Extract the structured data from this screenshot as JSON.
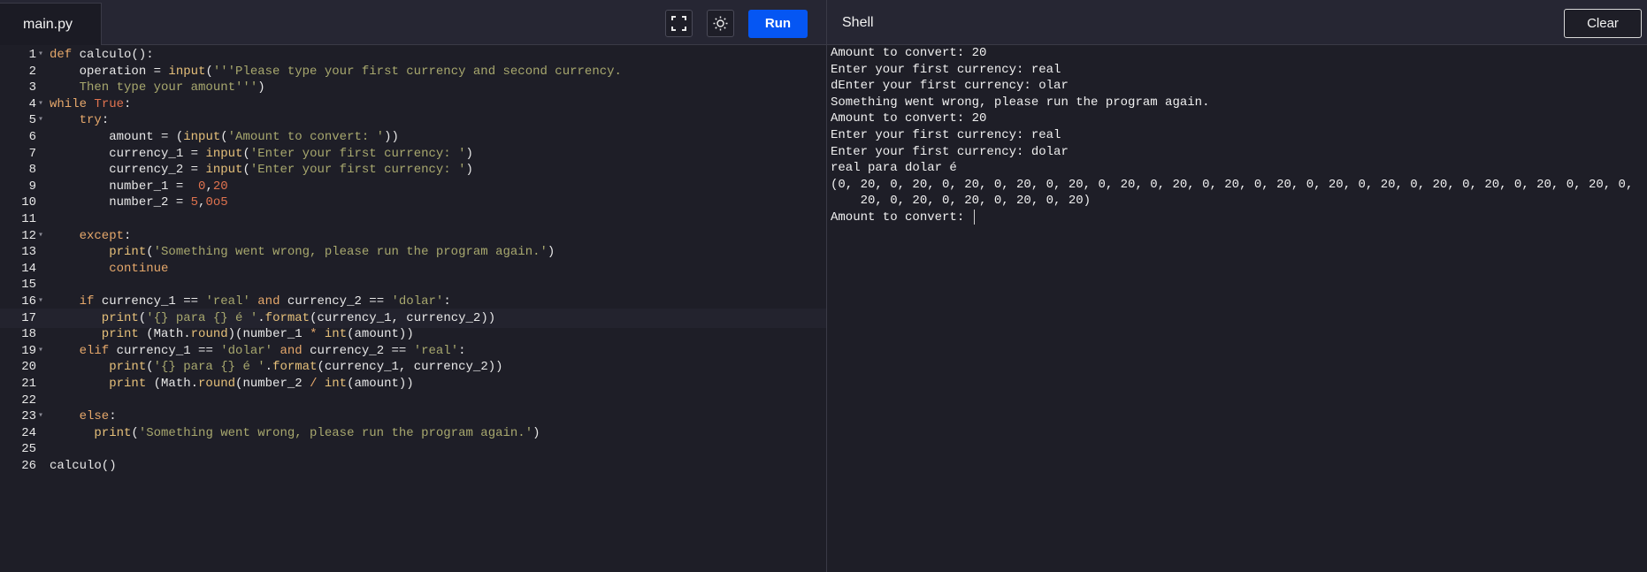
{
  "editor": {
    "tab_label": "main.py",
    "run_label": "Run",
    "lines": [
      {
        "num": "1",
        "fold": true,
        "tokens": [
          [
            "k",
            "def "
          ],
          [
            "t",
            "calculo():"
          ]
        ]
      },
      {
        "num": "2",
        "fold": false,
        "tokens": [
          [
            "t",
            "    operation = "
          ],
          [
            "f",
            "input"
          ],
          [
            "t",
            "("
          ],
          [
            "s",
            "'''Please type your first currency and second currency."
          ]
        ]
      },
      {
        "num": "3",
        "fold": false,
        "tokens": [
          [
            "s",
            "    Then type your amount'''"
          ],
          [
            "t",
            ")"
          ]
        ]
      },
      {
        "num": "4",
        "fold": true,
        "tokens": [
          [
            "k",
            "while "
          ],
          [
            "n",
            "True"
          ],
          [
            "t",
            ":"
          ]
        ]
      },
      {
        "num": "5",
        "fold": true,
        "tokens": [
          [
            "k",
            "    try"
          ],
          [
            "t",
            ":"
          ]
        ]
      },
      {
        "num": "6",
        "fold": false,
        "tokens": [
          [
            "t",
            "        amount = ("
          ],
          [
            "f",
            "input"
          ],
          [
            "t",
            "("
          ],
          [
            "s",
            "'Amount to convert: '"
          ],
          [
            "t",
            "))"
          ]
        ]
      },
      {
        "num": "7",
        "fold": false,
        "tokens": [
          [
            "t",
            "        currency_1 = "
          ],
          [
            "f",
            "input"
          ],
          [
            "t",
            "("
          ],
          [
            "s",
            "'Enter your first currency: '"
          ],
          [
            "t",
            ")"
          ]
        ]
      },
      {
        "num": "8",
        "fold": false,
        "tokens": [
          [
            "t",
            "        currency_2 = "
          ],
          [
            "f",
            "input"
          ],
          [
            "t",
            "("
          ],
          [
            "s",
            "'Enter your first currency: '"
          ],
          [
            "t",
            ")"
          ]
        ]
      },
      {
        "num": "9",
        "fold": false,
        "tokens": [
          [
            "t",
            "        number_1 =  "
          ],
          [
            "n",
            "0"
          ],
          [
            "t",
            ","
          ],
          [
            "n",
            "20"
          ]
        ]
      },
      {
        "num": "10",
        "fold": false,
        "tokens": [
          [
            "t",
            "        number_2 = "
          ],
          [
            "n",
            "5"
          ],
          [
            "t",
            ","
          ],
          [
            "n",
            "0o5"
          ]
        ]
      },
      {
        "num": "11",
        "fold": false,
        "tokens": []
      },
      {
        "num": "12",
        "fold": true,
        "tokens": [
          [
            "k",
            "    except"
          ],
          [
            "t",
            ":"
          ]
        ]
      },
      {
        "num": "13",
        "fold": false,
        "tokens": [
          [
            "f",
            "        print"
          ],
          [
            "t",
            "("
          ],
          [
            "s",
            "'Something went wrong, please run the program again.'"
          ],
          [
            "t",
            ")"
          ]
        ]
      },
      {
        "num": "14",
        "fold": false,
        "tokens": [
          [
            "k",
            "        continue"
          ]
        ]
      },
      {
        "num": "15",
        "fold": false,
        "tokens": []
      },
      {
        "num": "16",
        "fold": true,
        "tokens": [
          [
            "k",
            "    if "
          ],
          [
            "t",
            "currency_1 == "
          ],
          [
            "s",
            "'real'"
          ],
          [
            "k",
            " and "
          ],
          [
            "t",
            "currency_2 == "
          ],
          [
            "s",
            "'dolar'"
          ],
          [
            "t",
            ":"
          ]
        ]
      },
      {
        "num": "17",
        "fold": false,
        "tokens": [
          [
            "f",
            "       print"
          ],
          [
            "t",
            "("
          ],
          [
            "s",
            "'{} para {} é '"
          ],
          [
            "t",
            "."
          ],
          [
            "f",
            "format"
          ],
          [
            "t",
            "(currency_1, currency_2))"
          ]
        ]
      },
      {
        "num": "18",
        "fold": false,
        "tokens": [
          [
            "f",
            "       print"
          ],
          [
            "t",
            " (Math."
          ],
          [
            "f",
            "round"
          ],
          [
            "t",
            ")(number_1 "
          ],
          [
            "k",
            "*"
          ],
          [
            "t",
            " "
          ],
          [
            "f",
            "int"
          ],
          [
            "t",
            "(amount))"
          ]
        ]
      },
      {
        "num": "19",
        "fold": true,
        "tokens": [
          [
            "k",
            "    elif "
          ],
          [
            "t",
            "currency_1 == "
          ],
          [
            "s",
            "'dolar'"
          ],
          [
            "k",
            " and "
          ],
          [
            "t",
            "currency_2 == "
          ],
          [
            "s",
            "'real'"
          ],
          [
            "t",
            ":"
          ]
        ]
      },
      {
        "num": "20",
        "fold": false,
        "tokens": [
          [
            "f",
            "        print"
          ],
          [
            "t",
            "("
          ],
          [
            "s",
            "'{} para {} é '"
          ],
          [
            "t",
            "."
          ],
          [
            "f",
            "format"
          ],
          [
            "t",
            "(currency_1, currency_2))"
          ]
        ]
      },
      {
        "num": "21",
        "fold": false,
        "tokens": [
          [
            "f",
            "        print"
          ],
          [
            "t",
            " (Math."
          ],
          [
            "f",
            "round"
          ],
          [
            "t",
            "(number_2 "
          ],
          [
            "k",
            "/"
          ],
          [
            "t",
            " "
          ],
          [
            "f",
            "int"
          ],
          [
            "t",
            "(amount))"
          ]
        ]
      },
      {
        "num": "22",
        "fold": false,
        "tokens": []
      },
      {
        "num": "23",
        "fold": true,
        "tokens": [
          [
            "k",
            "    else"
          ],
          [
            "t",
            ":"
          ]
        ]
      },
      {
        "num": "24",
        "fold": false,
        "tokens": [
          [
            "f",
            "      print"
          ],
          [
            "t",
            "("
          ],
          [
            "s",
            "'Something went wrong, please run the program again.'"
          ],
          [
            "t",
            ")"
          ]
        ]
      },
      {
        "num": "25",
        "fold": false,
        "tokens": []
      },
      {
        "num": "26",
        "fold": false,
        "tokens": [
          [
            "t",
            "calculo()"
          ]
        ]
      }
    ],
    "active_line": 17
  },
  "shell": {
    "title": "Shell",
    "clear_label": "Clear",
    "output": [
      "Amount to convert: 20",
      "Enter your first currency: real",
      "dEnter your first currency: olar",
      "Something went wrong, please run the program again.",
      "Amount to convert: 20",
      "Enter your first currency: real",
      "Enter your first currency: dolar",
      "real para dolar é",
      "(0, 20, 0, 20, 0, 20, 0, 20, 0, 20, 0, 20, 0, 20, 0, 20, 0, 20, 0, 20, 0, 20, 0, 20, 0, 20, 0, 20, 0, 20, 0,",
      "    20, 0, 20, 0, 20, 0, 20, 0, 20)",
      "Amount to convert: "
    ]
  },
  "icons": {
    "fullscreen": "fullscreen-icon",
    "theme": "sun-icon"
  }
}
